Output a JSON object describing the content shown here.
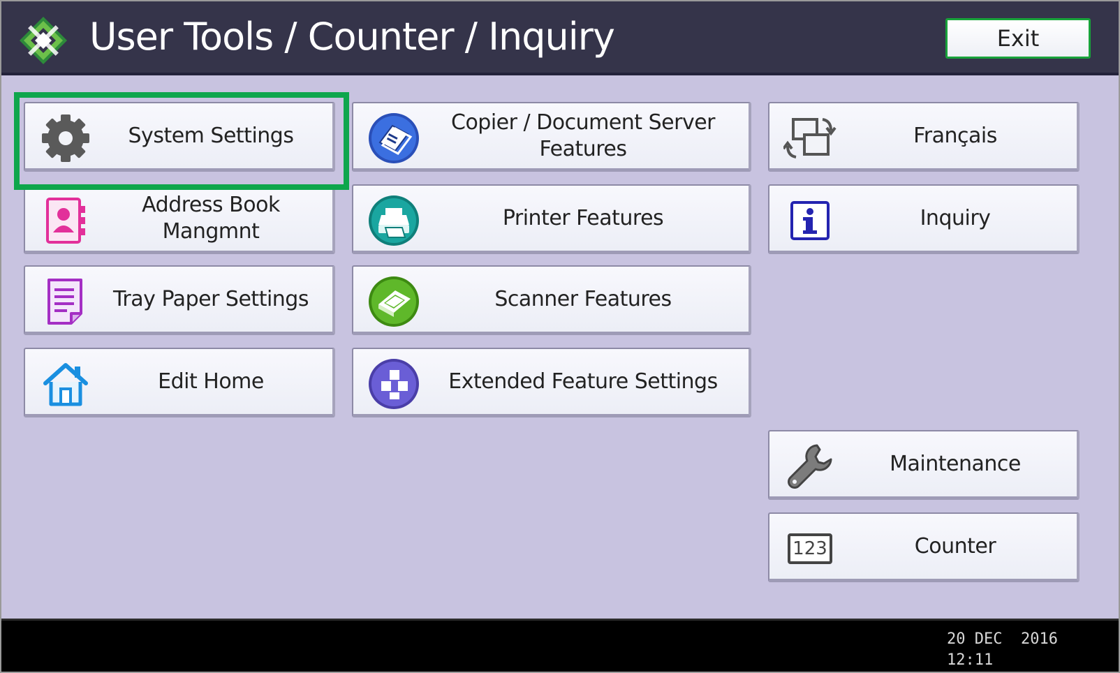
{
  "header": {
    "title": "User Tools / Counter / Inquiry",
    "exit_label": "Exit"
  },
  "buttons": {
    "system_settings": "System Settings",
    "address_book": "Address Book Mangmnt",
    "tray_paper": "Tray Paper Settings",
    "edit_home": "Edit Home",
    "copier_line1": "Copier / Document Server",
    "copier_line2": "Features",
    "printer": "Printer Features",
    "scanner": "Scanner Features",
    "extended": "Extended Feature Settings",
    "language": "Français",
    "inquiry": "Inquiry",
    "maintenance": "Maintenance",
    "counter": "Counter",
    "counter_icon_text": "123"
  },
  "footer": {
    "date": "20 DEC  2016",
    "time": "12:11"
  },
  "colors": {
    "header_bg": "#35344a",
    "panel_bg": "#c8c3e0",
    "selection_highlight": "#0ea64c",
    "exit_border": "#18a23a"
  }
}
